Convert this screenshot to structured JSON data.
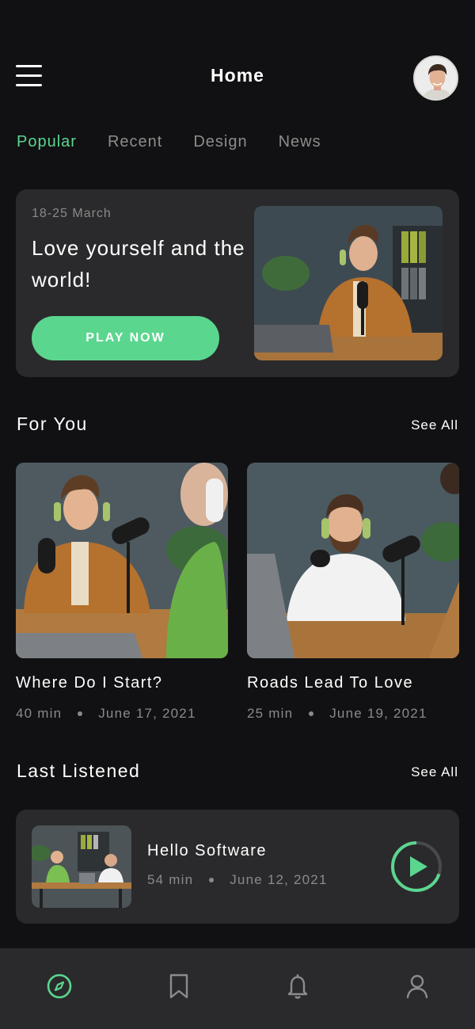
{
  "header": {
    "title": "Home",
    "menu_icon": "hamburger-menu-icon",
    "avatar_icon": "user-avatar"
  },
  "tabs": [
    {
      "label": "Popular",
      "active": true
    },
    {
      "label": "Recent",
      "active": false
    },
    {
      "label": "Design",
      "active": false
    },
    {
      "label": "News",
      "active": false
    }
  ],
  "hero": {
    "date": "18-25 March",
    "title": "Love yourself and the world!",
    "button_label": "PLAY NOW"
  },
  "for_you": {
    "title": "For You",
    "see_all": "See All",
    "cards": [
      {
        "title": "Where Do I Start?",
        "duration": "40 min",
        "date": "June 17, 2021"
      },
      {
        "title": "Roads Lead To Love",
        "duration": "25 min",
        "date": "June 19, 2021"
      }
    ]
  },
  "last_listened": {
    "title": "Last Listened",
    "see_all": "See All",
    "item": {
      "title": "Hello Software",
      "duration": "54 min",
      "date": "June 12, 2021",
      "progress": 0.3
    }
  },
  "bottom_nav": {
    "items": [
      "compass-icon",
      "bookmark-icon",
      "bell-icon",
      "profile-icon"
    ],
    "active": "compass-icon"
  },
  "colors": {
    "background": "#111113",
    "card": "#2a2a2c",
    "accent": "#5bd68f",
    "muted_text": "#8a8a8a"
  }
}
